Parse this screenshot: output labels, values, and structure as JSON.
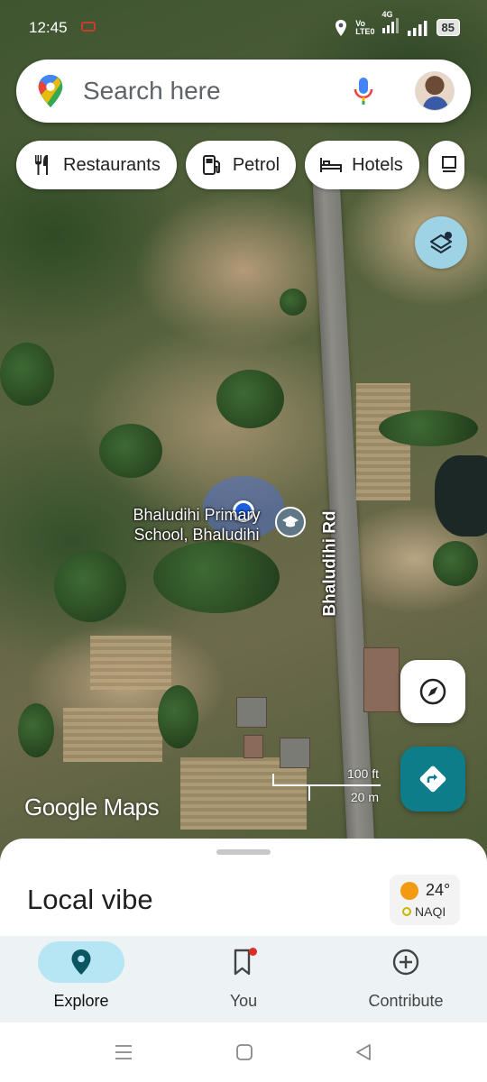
{
  "status_bar": {
    "time": "12:45",
    "network_label": "Vo",
    "network_sub": "LTE0",
    "signal_4g": "4G",
    "battery": "85"
  },
  "search": {
    "placeholder": "Search here"
  },
  "chips": [
    {
      "label": "Restaurants",
      "icon": "fork-knife-icon"
    },
    {
      "label": "Petrol",
      "icon": "fuel-pump-icon"
    },
    {
      "label": "Hotels",
      "icon": "bed-icon"
    }
  ],
  "map": {
    "road_label": "Bhaludihi Rd",
    "poi_label": "Bhaludihi Primary School, Bhaludihi",
    "scale_ft": "100 ft",
    "scale_m": "20 m",
    "logo": "Google Maps"
  },
  "sheet": {
    "title": "Local vibe",
    "weather_temp": "24°",
    "weather_aq": "NAQI"
  },
  "nav": [
    {
      "label": "Explore",
      "icon": "location-pin-icon",
      "active": true
    },
    {
      "label": "You",
      "icon": "bookmark-icon",
      "active": false
    },
    {
      "label": "Contribute",
      "icon": "add-circle-icon",
      "active": false
    }
  ],
  "colors": {
    "accent_teal": "#0c7d89",
    "explore_active": "#b6e6f3",
    "location_dot": "#1a5fe0"
  }
}
